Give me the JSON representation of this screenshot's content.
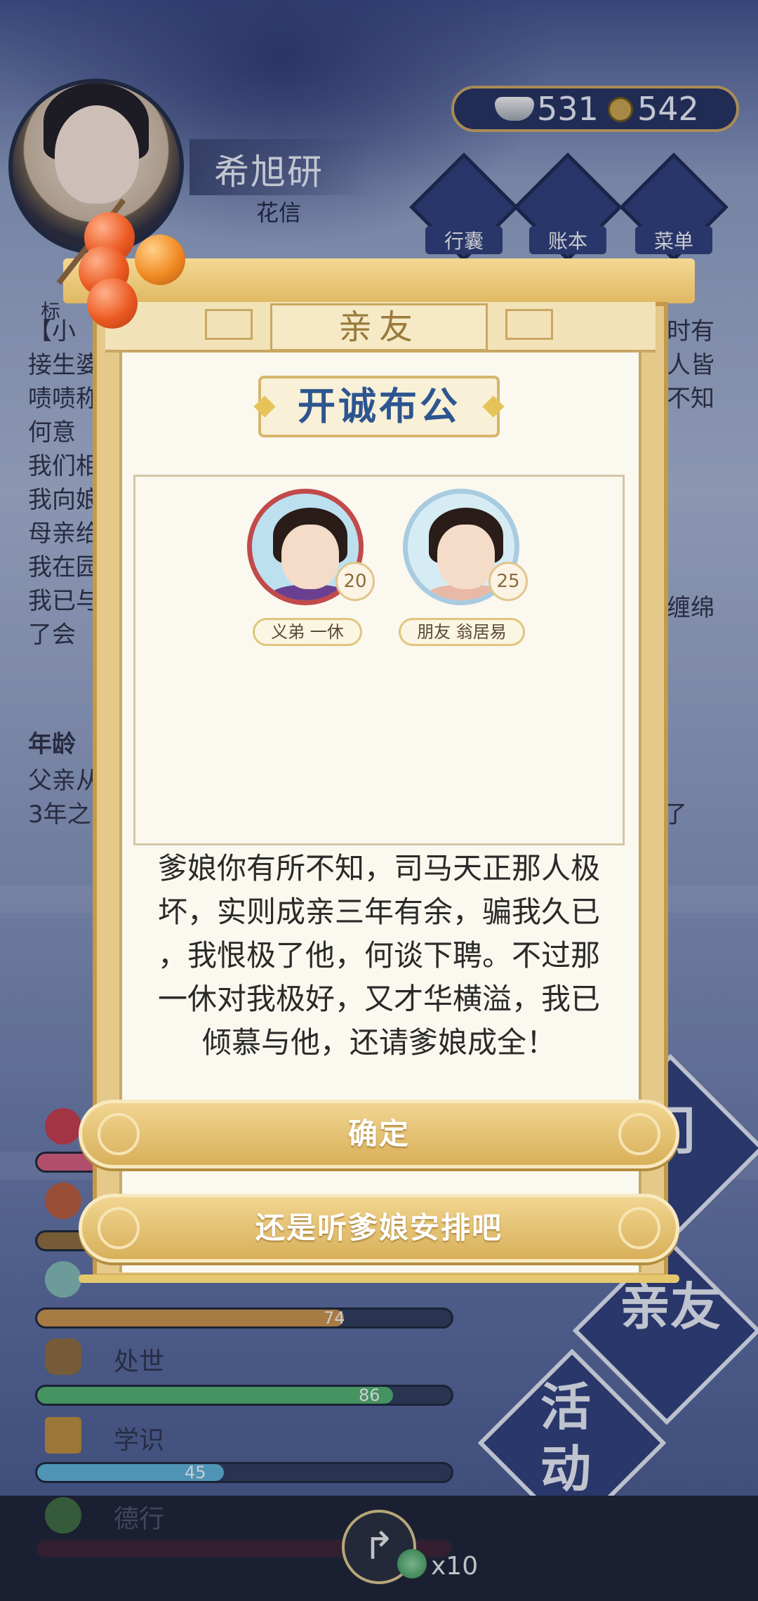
{
  "player": {
    "name": "希旭研",
    "subtitle": "花信"
  },
  "currency": {
    "silver": "531",
    "copper": "542"
  },
  "top_buttons": [
    {
      "label": "行囊"
    },
    {
      "label": "账本"
    },
    {
      "label": "菜单"
    }
  ],
  "background_story": {
    "tag": "标",
    "lines_left": [
      "【小",
      "接生婆",
      "啧啧称",
      "何意",
      "我们相",
      "我向娘",
      "母亲给",
      "我在园",
      "我已与",
      "了会"
    ],
    "lines_right": [
      "时有",
      "人皆",
      "不知",
      "缠绵"
    ],
    "age_heading": "年龄",
    "age_lines": [
      "父亲从",
      "3年之"
    ],
    "age_lines_right": [
      "了"
    ]
  },
  "stats": [
    {
      "name": "",
      "value": "",
      "fill": 0.28,
      "color": "#d45a7a"
    },
    {
      "name": "",
      "value": "",
      "fill": 0.15,
      "color": "#8a6b3a"
    },
    {
      "name": "",
      "value": "74",
      "fill": 0.74,
      "color": "#c7904a"
    },
    {
      "name": "处世",
      "value": "86",
      "fill": 0.86,
      "color": "#4fae6d"
    },
    {
      "name": "学识",
      "value": "45",
      "fill": 0.45,
      "color": "#5dafd3"
    },
    {
      "name": "德行",
      "value": "",
      "fill": 0.0,
      "color": "#b04a6a"
    }
  ],
  "side_diamonds": [
    {
      "label": "门"
    },
    {
      "label": "亲友"
    },
    {
      "label": "活动"
    }
  ],
  "dialog": {
    "header": "亲友",
    "title": "开诚布公",
    "characters": [
      {
        "relation_name": "义弟 一休",
        "age": "20",
        "ring_color": "#c24a4a",
        "robe_color": "#6b3f8f"
      },
      {
        "relation_name": "朋友 翁居易",
        "age": "25",
        "ring_color": "#a9cbe0",
        "robe_color": "#e8b9a6"
      }
    ],
    "message": "爹娘你有所不知，司马天正那人极坏，实则成亲三年有余，骗我久已，我恨极了他，何谈下聘。不过那一休对我极好，又才华横溢，我已倾慕与他，还请爹娘成全！",
    "message_lines": [
      "爹娘你有所不知，司马天正那人极",
      "坏，实则成亲三年有余，骗我久已",
      "，我恨极了他，何谈下聘。不过那",
      "一休对我极好，又才华横溢，我已",
      "倾慕与他，还请爹娘成全！"
    ],
    "confirm_label": "确定",
    "alt_label": "还是听爹娘安排吧"
  },
  "bottom": {
    "share_glyph": "↱",
    "multiplier": "x10"
  }
}
